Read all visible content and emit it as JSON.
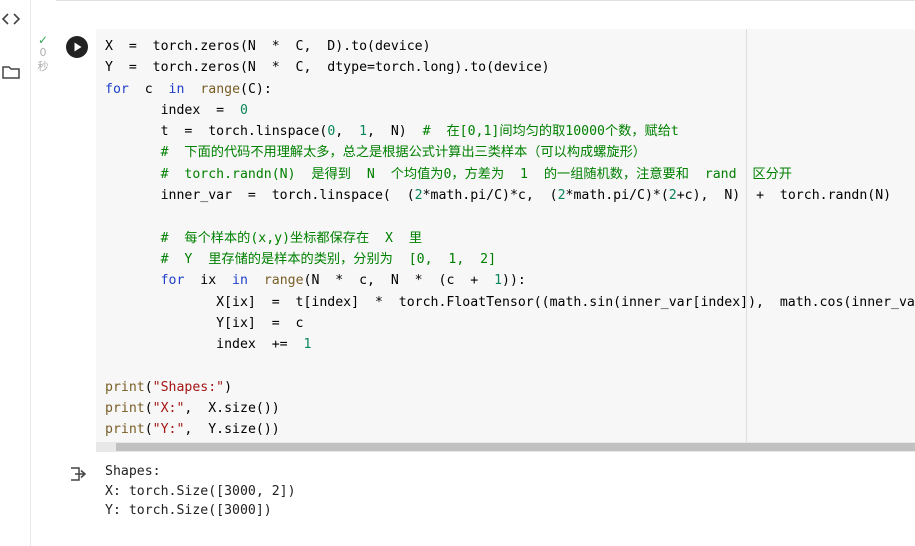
{
  "rail": {
    "code_icon": "code-brackets-icon",
    "folder_icon": "folder-icon"
  },
  "cell": {
    "status_count": "0",
    "status_unit": "秒",
    "code_lines": [
      "X  =  torch.zeros(N  *  C,  D).to(device)",
      "Y  =  torch.zeros(N  *  C,  dtype=torch.long).to(device)",
      "for  c  in  range(C):",
      "       index  =  0",
      "       t  =  torch.linspace(0,  1,  N)  #  在[0,1]间均匀的取10000个数，赋给t",
      "       #  下面的代码不用理解太多，总之是根据公式计算出三类样本（可以构成螺旋形）",
      "       #  torch.randn(N)  是得到  N  个均值为0，方差为  1  的一组随机数，注意要和  rand  区分开",
      "       inner_var  =  torch.linspace(  (2*math.pi/C)*c,  (2*math.pi/C)*(2+c),  N)  +  torch.randn(N)",
      "",
      "       #  每个样本的(x,y)坐标都保存在  X  里",
      "       #  Y  里存储的是样本的类别，分别为  [0,  1,  2]",
      "       for  ix  in  range(N  *  c,  N  *  (c  +  1)):",
      "              X[ix]  =  t[index]  *  torch.FloatTensor((math.sin(inner_var[index]),  math.cos(inner_var[index])))",
      "              Y[ix]  =  c",
      "              index  +=  1",
      "",
      "print(\"Shapes:\")",
      "print(\"X:\",  X.size())",
      "print(\"Y:\",  Y.size())"
    ]
  },
  "output": {
    "lines": [
      "Shapes:",
      "X: torch.Size([3000, 2])",
      "Y: torch.Size([3000])"
    ]
  },
  "colors": {
    "keyword": "#2040c8",
    "number": "#098658",
    "string": "#a31515",
    "comment": "#008000",
    "check": "#34a853"
  }
}
